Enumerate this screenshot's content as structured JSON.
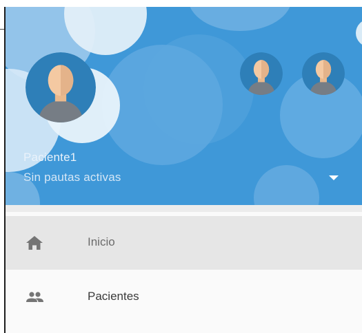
{
  "header": {
    "user_name": "Paciente1",
    "user_status": "Sin pautas activas",
    "colors": {
      "background": "#3f98d8",
      "bubble": "#7ab6e6"
    }
  },
  "menu": {
    "items": [
      {
        "label": "Inicio",
        "icon": "home-icon",
        "active": true
      },
      {
        "label": "Pacientes",
        "icon": "people-icon",
        "active": false
      }
    ]
  }
}
